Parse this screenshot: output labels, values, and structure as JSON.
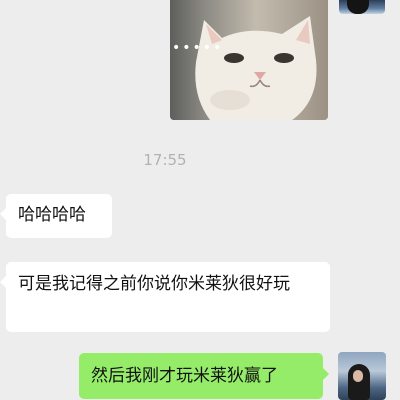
{
  "chat": {
    "timestamp": "17:55",
    "messages": [
      {
        "from": "other",
        "text": "哈哈哈哈"
      },
      {
        "from": "other",
        "text": "可是我记得之前你说你米莱狄很好玩"
      },
      {
        "from": "me",
        "text": "然后我刚才玩米莱狄赢了"
      }
    ],
    "sticker": {
      "dots": "•••••"
    }
  },
  "colors": {
    "background": "#ededed",
    "other_bubble": "#ffffff",
    "my_bubble": "#95ec69",
    "timestamp": "#b2b2b2"
  }
}
